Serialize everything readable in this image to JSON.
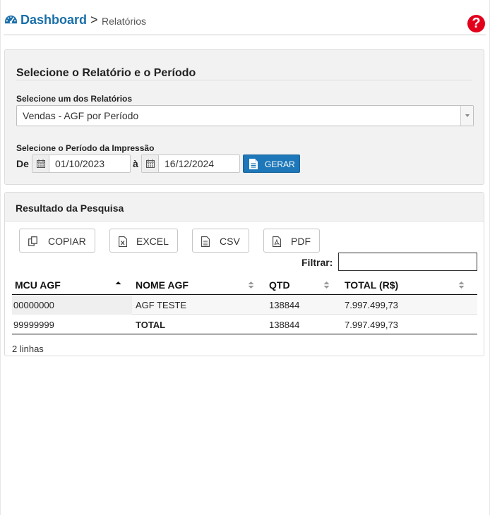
{
  "header": {
    "title": "Dashboard",
    "separator": ">",
    "breadcrumb_current": "Relatórios",
    "help": "?",
    "colors": {
      "title": "#1a6fa9",
      "help_bg": "#e3001b"
    },
    "icons": {
      "dashboard": "dashboard-gauge-icon",
      "help": "help-icon"
    }
  },
  "report_panel": {
    "title": "Selecione o Relatório e o Período",
    "report_label": "Selecione um dos Relatórios",
    "report_selected": "Vendas - AGF por Período",
    "period_label": "Selecione o Período da Impressão",
    "from_label": "De",
    "to_label": "à",
    "date_from": "01/10/2023",
    "date_to": "16/12/2024",
    "generate_button": "GERAR",
    "colors": {
      "generate_bg": "#1d77b8"
    }
  },
  "results_panel": {
    "title": "Resultado da Pesquisa",
    "buttons": {
      "copy": "COPIAR",
      "excel": "EXCEL",
      "csv": "CSV",
      "pdf": "PDF"
    },
    "filter_label": "Filtrar:",
    "filter_value": "",
    "columns": [
      "MCU AGF",
      "NOME AGF",
      "QTD",
      "TOTAL (R$)"
    ],
    "rows": [
      [
        "00000000",
        "AGF TESTE",
        "138844",
        "7.997.499,73"
      ],
      [
        "99999999",
        "TOTAL",
        "138844",
        "7.997.499,73"
      ]
    ],
    "row_count": "2 linhas"
  }
}
